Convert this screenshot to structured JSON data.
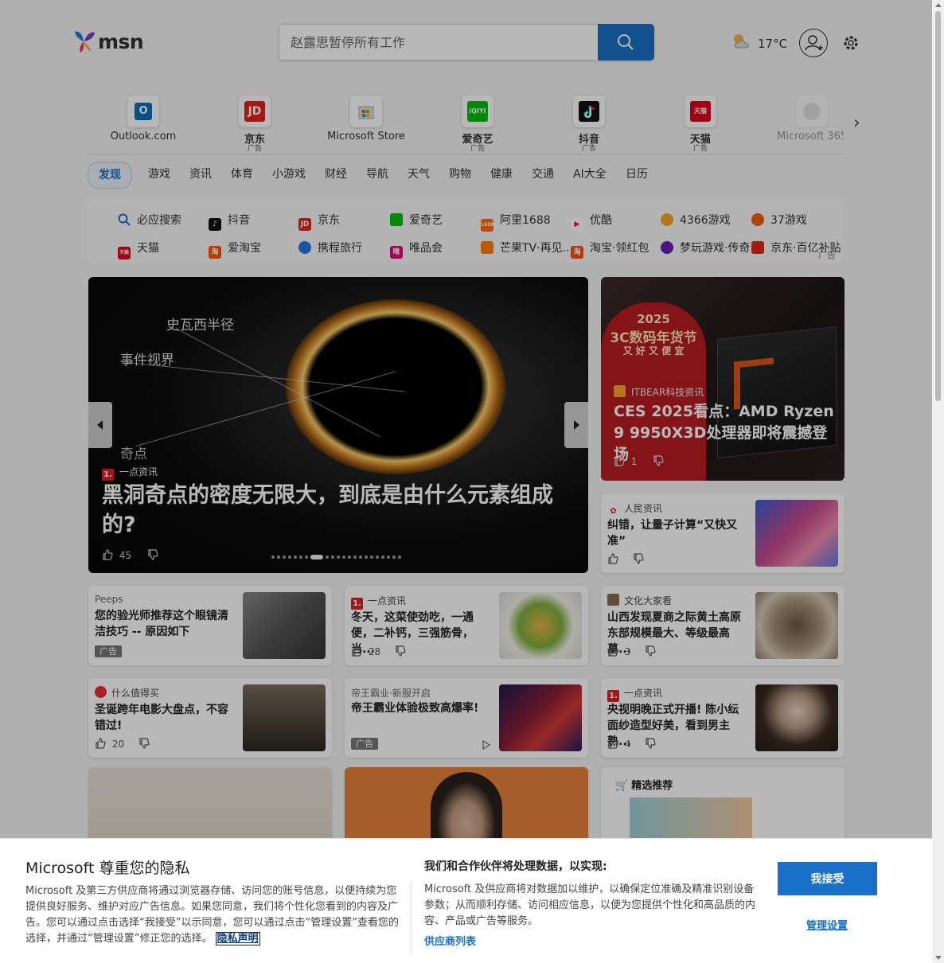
{
  "header": {
    "logo_text": "msn",
    "search_placeholder": "赵露思暂停所有工作",
    "weather_temp": "17°C"
  },
  "quick_links": [
    {
      "label": "Outlook.com",
      "ad": ""
    },
    {
      "label": "京东",
      "ad": "广告"
    },
    {
      "label": "Microsoft Store",
      "ad": ""
    },
    {
      "label": "爱奇艺",
      "ad": "广告"
    },
    {
      "label": "抖音",
      "ad": "广告"
    },
    {
      "label": "天猫",
      "ad": "广告"
    },
    {
      "label": "Microsoft 365",
      "ad": ""
    }
  ],
  "quick_icon_text": {
    "jd": "JD",
    "iqiyi": "iQIYI",
    "tmall": "天猫"
  },
  "tabs": [
    "发现",
    "游戏",
    "资讯",
    "体育",
    "小游戏",
    "财经",
    "导航",
    "天气",
    "购物",
    "健康",
    "交通",
    "AI大全",
    "日历"
  ],
  "links": {
    "row1": [
      "必应搜索",
      "抖音",
      "京东",
      "爱奇艺",
      "阿里1688",
      "优酷",
      "4366游戏",
      "37游戏"
    ],
    "row2": [
      "天猫",
      "爱淘宝",
      "携程旅行",
      "唯品会",
      "芒果TV·再见...",
      "淘宝·领红包",
      "梦玩游戏·传奇",
      "京东·百亿补贴"
    ],
    "ad_label": "广告",
    "icon_text": {
      "jd": "JD",
      "ali": "1688",
      "tmall": "天猫",
      "taobao": "淘",
      "vip": "唯",
      "tb2": "淘"
    }
  },
  "hero": {
    "source": "一点资讯",
    "title": "黑洞奇点的密度无限大，到底是由什么元素组成的?",
    "likes": "45",
    "labels": {
      "schwarzschild": "史瓦西半径",
      "horizon": "事件视界",
      "singularity": "奇点"
    },
    "badge": "1.",
    "dot_count": 22,
    "active_dot": 7
  },
  "promo": {
    "source": "ITBEAR科技资讯",
    "title": "CES 2025看点：AMD Ryzen 9 9950X3D处理器即将震撼登场",
    "likes": "1",
    "banner_year": "2025",
    "banner_title": "3C数码年货节",
    "banner_sub": "又 好 又 便 宜"
  },
  "news_side": {
    "source": "人民资讯",
    "title": "纠错，让量子计算“又快又准”"
  },
  "cards": [
    {
      "source": "Peeps",
      "title": "您的验光师推荐这个眼镜清洁技巧 -- 原因如下",
      "likes": "",
      "ad": "广告"
    },
    {
      "source": "一点资讯",
      "title": "冬天，这菜使劲吃，一通便，二补钙，三强筋骨，当...",
      "likes": "28",
      "ad": "",
      "badge": "1."
    },
    {
      "source": "文化大家看",
      "title": "山西发现夏商之际黄土高原东部规模最大、等级最高墓...",
      "likes": "3",
      "ad": ""
    },
    {
      "source": "什么值得买",
      "title": "圣诞跨年电影大盘点，不容错过!",
      "likes": "20",
      "ad": ""
    },
    {
      "source": "帝王霸业·新服开启",
      "title": "帝王霸业体验极致高爆率!",
      "likes": "",
      "ad": "广告"
    },
    {
      "source": "一点资讯",
      "title": "央视明晚正式开播! 陈小纭面纱造型好美，看到男主熟...",
      "likes": "4",
      "ad": "",
      "badge": "1."
    }
  ],
  "featured": {
    "title": "精选推荐"
  },
  "privacy": {
    "title": "Microsoft 尊重您的隐私",
    "body": "Microsoft 及第三方供应商将通过浏览器存储、访问您的账号信息，以便持续为您提供良好服务、维护对应广告信息。如果您同意，我们将个性化您看到的内容及广告。您可以通过点击选择“我接受”以示同意，您可以通过点击“管理设置”查看您的选择，并通过“管理设置”修正您的选择。",
    "privacy_link": "隐私声明",
    "heading2": "我们和合作伙伴将处理数据，以实现:",
    "body2": "Microsoft 及供应商将对数据加以维护，以确保定位准确及精准识别设备参数；从而顺利存储、访问相应信息，以便为您提供个性化和高品质的内容、产品或广告等服务。",
    "vendors_link": "供应商列表",
    "accept": "我接受",
    "manage": "管理设置"
  },
  "colors": {
    "accent": "#1a6fc8",
    "badge_red": "#dd2222"
  }
}
